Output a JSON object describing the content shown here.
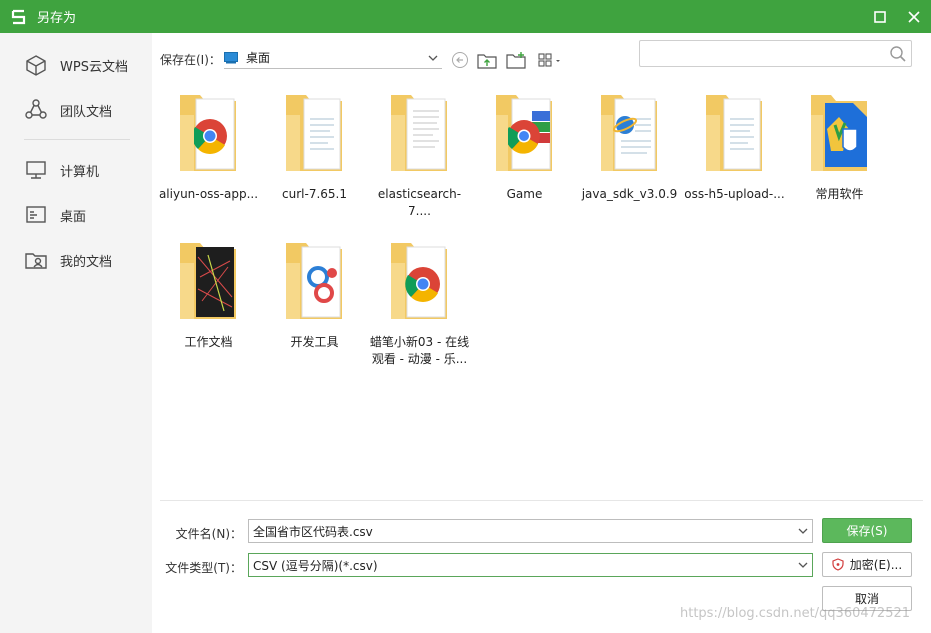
{
  "window": {
    "title": "另存为"
  },
  "sidebar": {
    "items": [
      {
        "label": "WPS云文档",
        "icon": "cube-icon"
      },
      {
        "label": "团队文档",
        "icon": "team-icon"
      },
      {
        "label": "计算机",
        "icon": "computer-icon"
      },
      {
        "label": "桌面",
        "icon": "desktop-icon"
      },
      {
        "label": "我的文档",
        "icon": "my-documents-icon"
      }
    ]
  },
  "toolbar": {
    "save_in_label": "保存在(I)：",
    "location": "桌面",
    "search_placeholder": ""
  },
  "files": [
    {
      "name": "aliyun-oss-app...",
      "kind": "chrome"
    },
    {
      "name": "curl-7.65.1",
      "kind": "doc"
    },
    {
      "name": "elasticsearch-7....",
      "kind": "doc"
    },
    {
      "name": "Game",
      "kind": "chrome-winrar"
    },
    {
      "name": "java_sdk_v3.0.9",
      "kind": "ie-doc"
    },
    {
      "name": "oss-h5-upload-...",
      "kind": "doc"
    },
    {
      "name": "常用软件",
      "kind": "blue-app"
    },
    {
      "name": "工作文档",
      "kind": "dark"
    },
    {
      "name": "开发工具",
      "kind": "apps"
    },
    {
      "name": "蜡笔小新03 - 在线观看 - 动漫 - 乐...",
      "kind": "chrome"
    }
  ],
  "form": {
    "filename_label": "文件名(N)：",
    "filename_value": "全国省市区代码表.csv",
    "filetype_label": "文件类型(T)：",
    "filetype_value": "CSV (逗号分隔)(*.csv)"
  },
  "buttons": {
    "save": "保存(S)",
    "encrypt": "加密(E)...",
    "cancel": "取消"
  },
  "watermark": "https://blog.csdn.net/qq360472521",
  "colors": {
    "accent": "#3fa33f",
    "save_button": "#5cb85c",
    "folder": "#f5d27a"
  }
}
